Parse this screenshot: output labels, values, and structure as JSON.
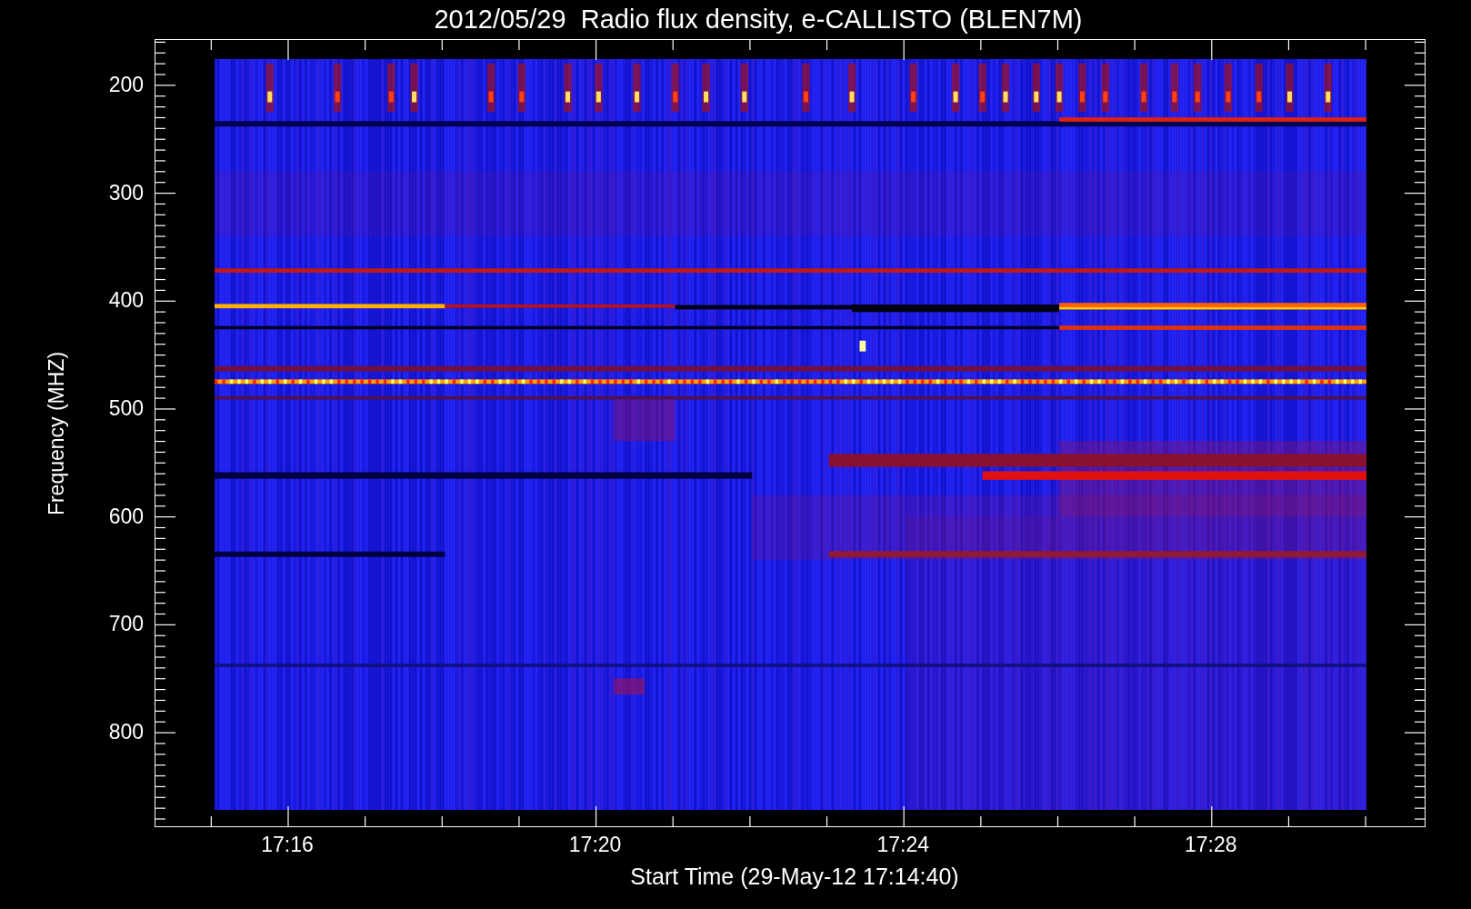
{
  "title": "2012/05/29  Radio flux density, e-CALLISTO (BLEN7M)",
  "y_axis": {
    "label": "Frequency (MHZ)",
    "ticks": [
      "200",
      "300",
      "400",
      "500",
      "600",
      "700",
      "800"
    ]
  },
  "x_axis": {
    "label": "Start Time (29-May-12 17:14:40)",
    "ticks": [
      "17:16",
      "17:20",
      "17:24",
      "17:28"
    ]
  }
}
